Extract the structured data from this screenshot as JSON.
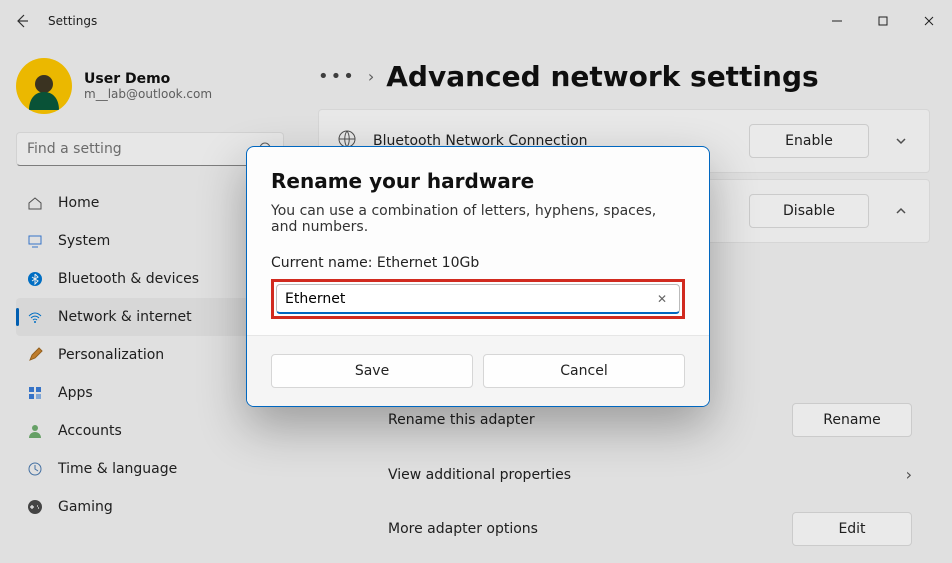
{
  "app_title": "Settings",
  "user": {
    "name": "User Demo",
    "email": "m__lab@outlook.com"
  },
  "search": {
    "placeholder": "Find a setting"
  },
  "nav": {
    "items": [
      {
        "label": "Home"
      },
      {
        "label": "System"
      },
      {
        "label": "Bluetooth & devices"
      },
      {
        "label": "Network & internet"
      },
      {
        "label": "Personalization"
      },
      {
        "label": "Apps"
      },
      {
        "label": "Accounts"
      },
      {
        "label": "Time & language"
      },
      {
        "label": "Gaming"
      }
    ],
    "active_index": 3
  },
  "page": {
    "title": "Advanced network settings",
    "cards": [
      {
        "label": "Bluetooth Network Connection",
        "button": "Enable",
        "expanded": false
      },
      {
        "label": "",
        "button": "Disable",
        "expanded": true
      }
    ],
    "rows": [
      {
        "label": "Rename this adapter",
        "button": "Rename"
      },
      {
        "label": "View additional properties",
        "button": ""
      },
      {
        "label": "More adapter options",
        "button": "Edit"
      }
    ]
  },
  "dialog": {
    "title": "Rename your hardware",
    "subtitle": "You can use a combination of letters, hyphens, spaces, and numbers.",
    "current_label": "Current name: Ethernet 10Gb",
    "input_value": "Ethernet",
    "save": "Save",
    "cancel": "Cancel"
  }
}
